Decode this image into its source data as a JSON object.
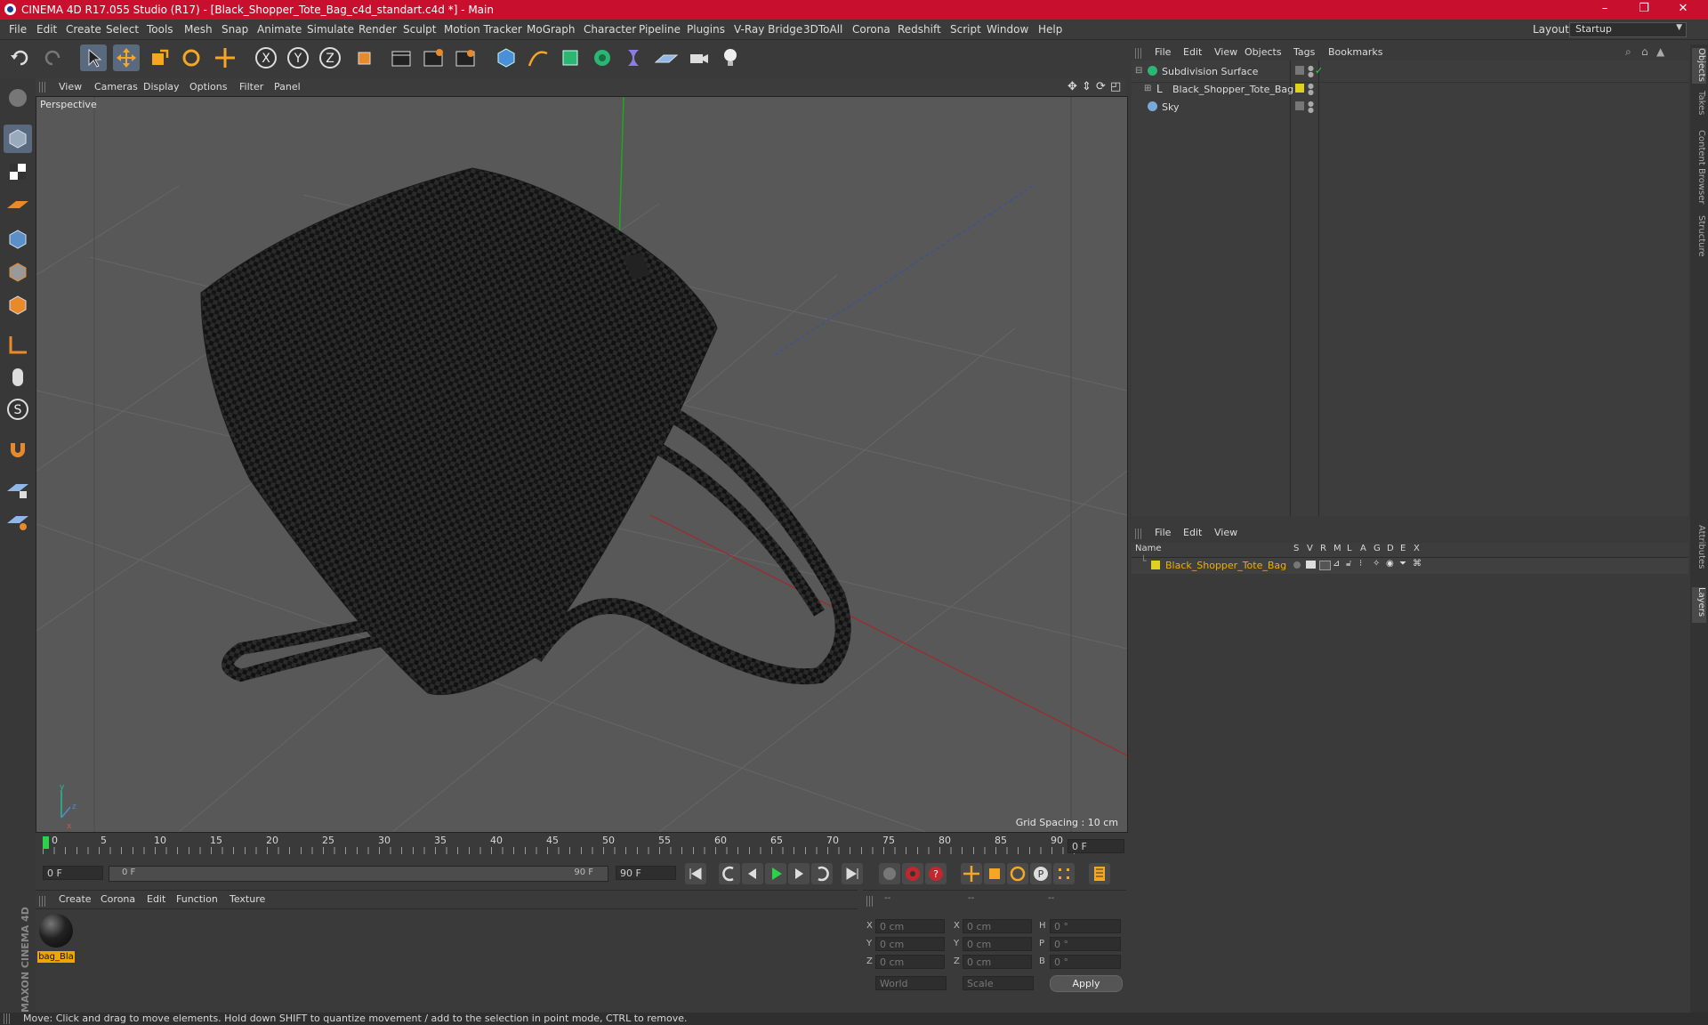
{
  "window": {
    "title": "CINEMA 4D R17.055 Studio (R17) - [Black_Shopper_Tote_Bag_c4d_standart.c4d *] - Main",
    "controls": [
      "–",
      "❐",
      "✕"
    ]
  },
  "menubar": {
    "items": [
      "File",
      "Edit",
      "Create",
      "Select",
      "Tools",
      "Mesh",
      "Snap",
      "Animate",
      "Simulate",
      "Render",
      "Sculpt",
      "Motion Tracker",
      "MoGraph",
      "Character",
      "Pipeline",
      "Plugins",
      "V-Ray Bridge",
      "3DToAll",
      "Corona",
      "Redshift",
      "Script",
      "Window",
      "Help"
    ],
    "layout_label": "Layout:",
    "layout_value": "Startup"
  },
  "viewport": {
    "menu": [
      "View",
      "Cameras",
      "Display",
      "Options",
      "Filter",
      "Panel"
    ],
    "label": "Perspective",
    "grid_spacing": "Grid Spacing : 10 cm"
  },
  "timeline": {
    "ticks": [
      "0",
      "5",
      "10",
      "15",
      "20",
      "25",
      "30",
      "35",
      "40",
      "45",
      "50",
      "55",
      "60",
      "65",
      "70",
      "75",
      "80",
      "85",
      "90"
    ],
    "current_frame": "0 F",
    "start_field": "0 F",
    "slider_start": "0 F",
    "slider_end": "90 F",
    "end_field": "90 F"
  },
  "material_manager": {
    "menu": [
      "Create",
      "Corona",
      "Edit",
      "Function",
      "Texture"
    ],
    "materials": [
      {
        "name": "bag_Bla"
      }
    ]
  },
  "coordinates": {
    "headers": [
      "--",
      "--",
      "--"
    ],
    "rows": [
      {
        "a": "X",
        "av": "0 cm",
        "b": "X",
        "bv": "0 cm",
        "c": "H",
        "cv": "0 °"
      },
      {
        "a": "Y",
        "av": "0 cm",
        "b": "Y",
        "bv": "0 cm",
        "c": "P",
        "cv": "0 °"
      },
      {
        "a": "Z",
        "av": "0 cm",
        "b": "Z",
        "bv": "0 cm",
        "c": "B",
        "cv": "0 °"
      }
    ],
    "mode_select": "World",
    "scale_select": "Scale",
    "apply": "Apply"
  },
  "object_manager": {
    "menu": [
      "File",
      "Edit",
      "View",
      "Objects",
      "Tags",
      "Bookmarks"
    ],
    "objects": [
      {
        "name": "Subdivision Surface",
        "icon": "subdivision-icon"
      },
      {
        "name": "Black_Shopper_Tote_Bag",
        "icon": "null-object-icon"
      },
      {
        "name": "Sky",
        "icon": "sky-icon"
      }
    ]
  },
  "layer_manager": {
    "menu": [
      "File",
      "Edit",
      "View"
    ],
    "columns": [
      "Name",
      "S",
      "V",
      "R",
      "M",
      "L",
      "A",
      "G",
      "D",
      "E",
      "X"
    ],
    "layers": [
      {
        "name": "Black_Shopper_Tote_Bag",
        "color": "#e0d020"
      }
    ]
  },
  "side_tabs": [
    "Objects",
    "Takes",
    "Content Browser",
    "Structure",
    "Attributes",
    "Layers"
  ],
  "status": "Move: Click and drag to move elements. Hold down SHIFT to quantize movement / add to the selection in point mode, CTRL to remove.",
  "brand": "MAXON CINEMA 4D"
}
